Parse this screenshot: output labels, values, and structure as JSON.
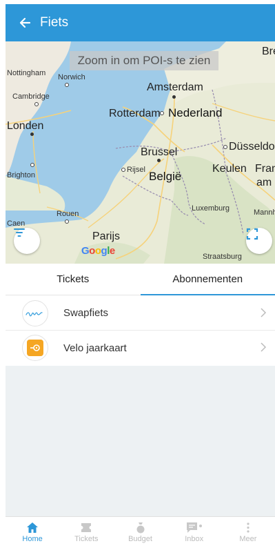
{
  "appbar": {
    "title": "Fiets",
    "back_icon": "arrow-left-icon",
    "color": "#2d97d8"
  },
  "map": {
    "zoom_hint": "Zoom in om POI-s te zien",
    "watermark": "Google",
    "labels": {
      "nottingham": "Nottingham",
      "norwich": "Norwich",
      "cambridge": "Cambridge",
      "londen": "Londen",
      "brighton": "Brighton",
      "amsterdam": "Amsterdam",
      "rotterdam": "Rotterdam",
      "nederland": "Nederland",
      "brussel": "Brussel",
      "rijsel": "Rijsel",
      "belgie": "België",
      "dusseldorf": "Düsseldor",
      "keulen": "Keulen",
      "fran": "Fran",
      "am": "am l",
      "rouen": "Rouen",
      "luxemburg": "Luxemburg",
      "mann": "Mannh",
      "parijs": "Parijs",
      "straatsburg": "Straatsburg",
      "bre": "Bre",
      "caen": "Caen"
    }
  },
  "tabs": [
    {
      "label": "Tickets",
      "active": false
    },
    {
      "label": "Abonnementen",
      "active": true
    }
  ],
  "subscriptions": [
    {
      "label": "Swapfiets",
      "logo_text": "Swapfiets"
    },
    {
      "label": "Velo jaarkaart",
      "logo_color": "#f5a623"
    }
  ],
  "nav": [
    {
      "label": "Home",
      "icon": "home-icon",
      "active": true
    },
    {
      "label": "Tickets",
      "icon": "ticket-icon",
      "active": false
    },
    {
      "label": "Budget",
      "icon": "money-bag-icon",
      "active": false
    },
    {
      "label": "Inbox",
      "icon": "inbox-icon",
      "active": false
    },
    {
      "label": "Meer",
      "icon": "more-vertical-icon",
      "active": false
    }
  ]
}
